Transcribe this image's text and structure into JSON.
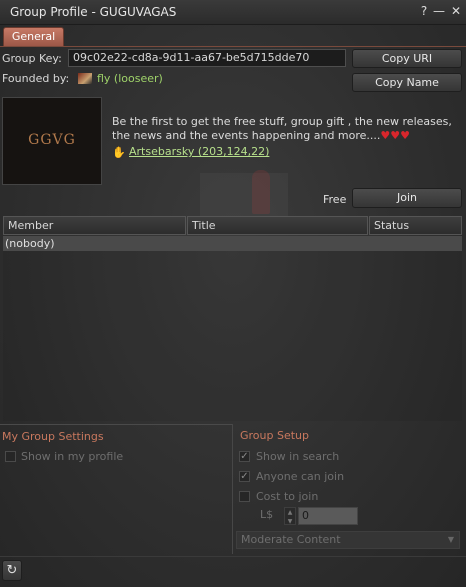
{
  "window": {
    "title": "Group Profile - GUGUVAGAS",
    "help_icon": "help-icon",
    "minimize_icon": "minimize-icon",
    "close_icon": "close-icon"
  },
  "tabs": [
    {
      "label": "General",
      "selected": true
    }
  ],
  "group_key": {
    "label": "Group Key:",
    "value": "09c02e22-cd8a-9d11-aa67-be5d715dde70",
    "copy_uri_label": "Copy URI"
  },
  "founded_by": {
    "label": "Founded by:",
    "name": "fly (looseer)",
    "copy_name_label": "Copy Name"
  },
  "logo": {
    "text": "GGVG"
  },
  "charter": {
    "text": "Be the first to get the free stuff, group gift , the new releases, the news and the events happening and more....",
    "hearts": "♥♥♥"
  },
  "location": {
    "icon": "landmark-icon",
    "text": "Artsebarsky (203,124,22)"
  },
  "membership": {
    "fee_label": "Free",
    "join_label": "Join"
  },
  "members_table": {
    "columns": [
      "Member",
      "Title",
      "Status"
    ],
    "rows": [
      "(nobody)"
    ]
  },
  "my_group_settings": {
    "title": "My Group Settings",
    "show_in_profile": {
      "label": "Show in my profile",
      "checked": false
    }
  },
  "group_setup": {
    "title": "Group Setup",
    "show_in_search": {
      "label": "Show in search",
      "checked": true
    },
    "anyone_can_join": {
      "label": "Anyone can join",
      "checked": true
    },
    "cost_to_join": {
      "label": "Cost to join",
      "checked": false
    },
    "currency_label": "L$",
    "fee_value": "0",
    "maturity": "Moderate Content"
  },
  "footer": {
    "refresh_icon": "refresh-icon"
  },
  "colors": {
    "accent": "#b56a55",
    "link": "#b7e08c",
    "founder": "#9fd36a",
    "section_title": "#c8785e",
    "hearts": "#d8262c"
  }
}
